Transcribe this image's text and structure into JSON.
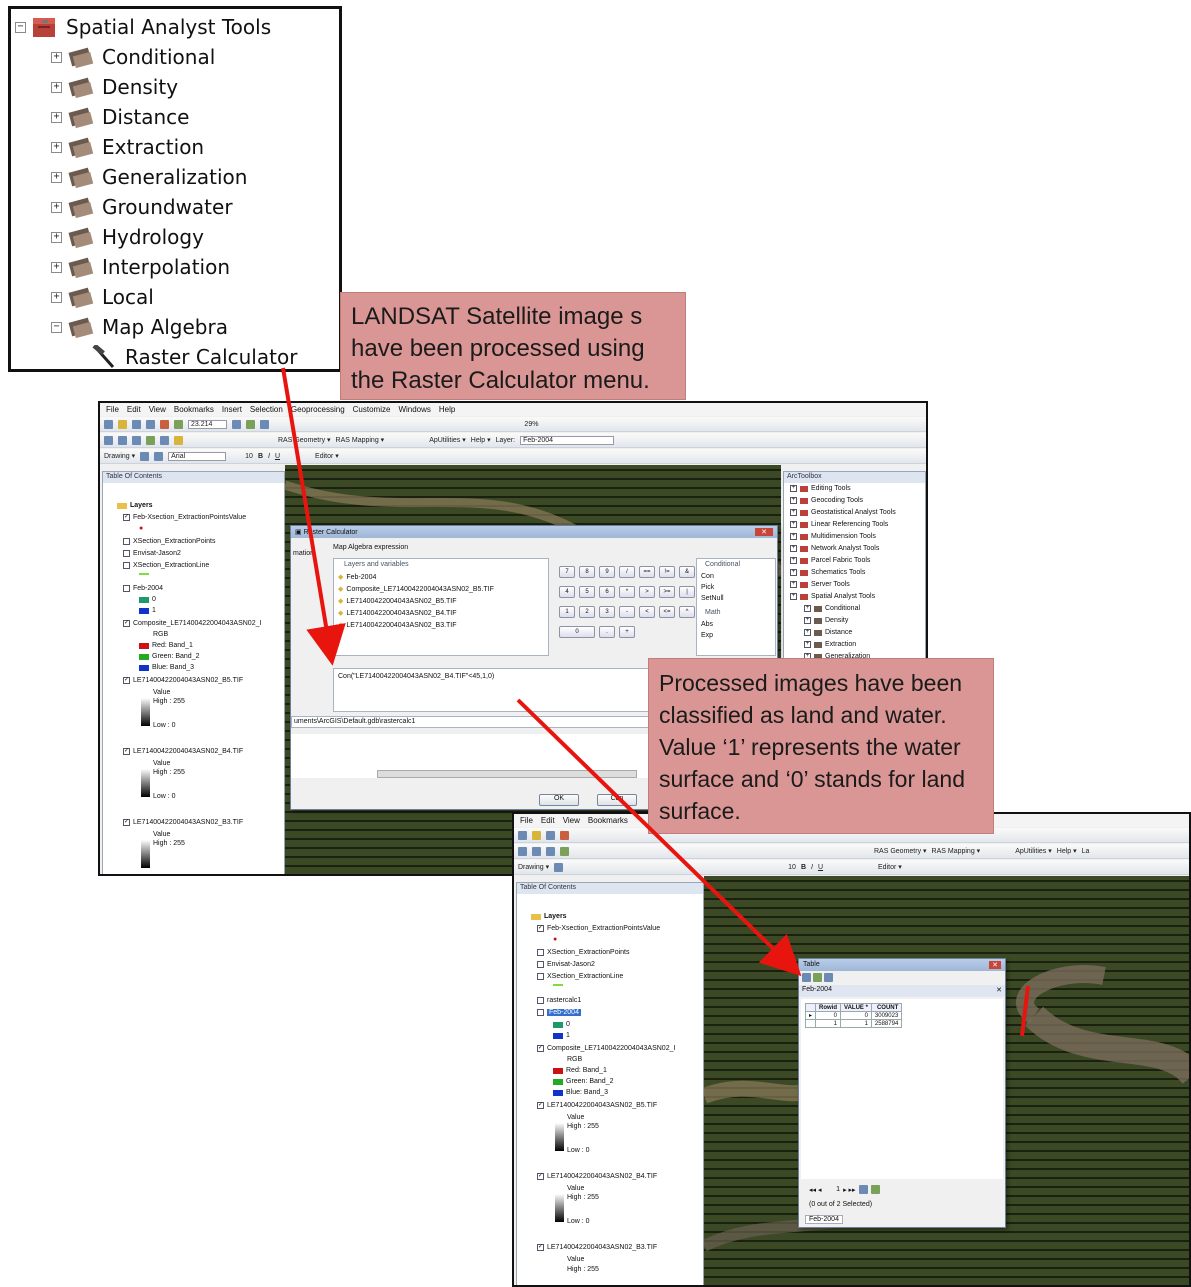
{
  "toolbox_tree": {
    "root": "Spatial Analyst Tools",
    "items": [
      "Conditional",
      "Density",
      "Distance",
      "Extraction",
      "Generalization",
      "Groundwater",
      "Hydrology",
      "Interpolation",
      "Local",
      "Map Algebra"
    ],
    "leaf": "Raster Calculator"
  },
  "callouts": {
    "one": "LANDSAT Satellite image s have been processed using the Raster Calculator menu.",
    "two": "Processed images  have been classified as  land and water. Value  ‘1’ represents the water surface and ‘0’ stands  for land surface."
  },
  "arcmap1": {
    "menu": [
      "File",
      "Edit",
      "View",
      "Bookmarks",
      "Insert",
      "Selection",
      "Geoprocessing",
      "Customize",
      "Windows",
      "Help"
    ],
    "scale": "23.214",
    "toolbar2": [
      "RAS Geometry ▾",
      "RAS Mapping ▾",
      "ApUtilities ▾",
      "Help ▾",
      "Layer:"
    ],
    "layer_value": "Feb-2004",
    "drawing": "Drawing ▾",
    "font": "Arial",
    "font_size": "10",
    "editor": "Editor ▾",
    "zoom": "29%",
    "toc_title": "Table Of Contents",
    "toc": {
      "layers": "Layers",
      "l1": "Feb-Xsection_ExtractionPointsValue",
      "l2": "XSection_ExtractionPoints",
      "l3": "Envisat-Jason2",
      "l4": "XSection_ExtractionLine",
      "l5": "Feb-2004",
      "v0": "0",
      "v1": "1",
      "l6": "Composite_LE71400422004043ASN02_I",
      "rgb": "RGB",
      "red": "Red:   Band_1",
      "green": "Green: Band_2",
      "blue": "Blue:  Band_3",
      "l7": "LE71400422004043ASN02_B5.TIF",
      "value": "Value",
      "high": "High : 255",
      "low": "Low : 0",
      "l8": "LE71400422004043ASN02_B4.TIF",
      "l9": "LE71400422004043ASN02_B3.TIF"
    },
    "arctoolbox_title": "ArcToolbox",
    "arctoolbox": [
      "Editing Tools",
      "Geocoding Tools",
      "Geostatistical Analyst Tools",
      "Linear Referencing Tools",
      "Multidimension Tools",
      "Network Analyst Tools",
      "Parcel Fabric Tools",
      "Schematics Tools",
      "Server Tools",
      "Spatial Analyst Tools",
      "Conditional",
      "Density",
      "Distance",
      "Extraction",
      "Generalization"
    ],
    "raster_calc": {
      "title": "Raster Calculator",
      "map_algebra": "Map Algebra expression",
      "layers_vars": "Layers and variables",
      "layers": [
        "Feb-2004",
        "Composite_LE71400422004043ASN02_B5.TIF",
        "LE71400422004043ASN02_B5.TIF",
        "LE71400422004043ASN02_B4.TIF",
        "LE71400422004043ASN02_B3.TIF"
      ],
      "keys": [
        "7",
        "8",
        "9",
        "/",
        "==",
        "!=",
        "&",
        "4",
        "5",
        "6",
        "*",
        ">",
        ">=",
        "|",
        "1",
        "2",
        "3",
        "-",
        "<",
        "<=",
        "^",
        "0",
        ".",
        "+"
      ],
      "conditional": "Conditional",
      "funcs": [
        "Con",
        "Pick",
        "SetNull"
      ],
      "math": "Math",
      "math_funcs": [
        "Abs",
        "Exp"
      ],
      "expression": "Con(\"LE71400422004043ASN02_B4.TIF\"<45,1,0)",
      "output": "uments\\ArcGIS\\Default.gdb\\rastercalc1",
      "ok": "OK",
      "cancel": "Can",
      "partial": "mation"
    }
  },
  "arcmap2": {
    "menu": [
      "File",
      "Edit",
      "View",
      "Bookmarks"
    ],
    "toc_title": "Table Of Contents",
    "toolbar2": [
      "RAS Geometry ▾",
      "RAS Mapping ▾",
      "ApUtilities ▾",
      "Help ▾",
      "La"
    ],
    "drawing": "Drawing ▾",
    "font_size": "10",
    "editor": "Editor ▾",
    "toc": {
      "layers": "Layers",
      "l1": "Feb-Xsection_ExtractionPointsValue",
      "l2": "XSection_ExtractionPoints",
      "l3": "Envisat-Jason2",
      "l4": "XSection_ExtractionLine",
      "l5": "rastercalc1",
      "l6": "Feb-2004",
      "v0": "0",
      "v1": "1",
      "l7": "Composite_LE71400422004043ASN02_I",
      "rgb": "RGB",
      "red": "Red:   Band_1",
      "green": "Green: Band_2",
      "blue": "Blue:  Band_3",
      "l8": "LE71400422004043ASN02_B5.TIF",
      "value": "Value",
      "high": "High : 255",
      "low": "Low : 0",
      "l9": "LE71400422004043ASN02_B4.TIF",
      "l10": "LE71400422004043ASN02_B3.TIF",
      "high_cut": "High : 255"
    },
    "table": {
      "title": "Table",
      "layer": "Feb-2004",
      "headers": [
        "Rowid",
        "VALUE *",
        "COUNT"
      ],
      "rows": [
        [
          "0",
          "0",
          "3009023"
        ],
        [
          "1",
          "1",
          "2588794"
        ]
      ],
      "nav": "1",
      "selected": "(0 out of 2 Selected)",
      "tab": "Feb-2004"
    }
  },
  "colors": {
    "callout": "#d99694",
    "arrow": "#e8150f",
    "red": "#cc1111",
    "green": "#22aa22",
    "blue": "#1133cc"
  }
}
